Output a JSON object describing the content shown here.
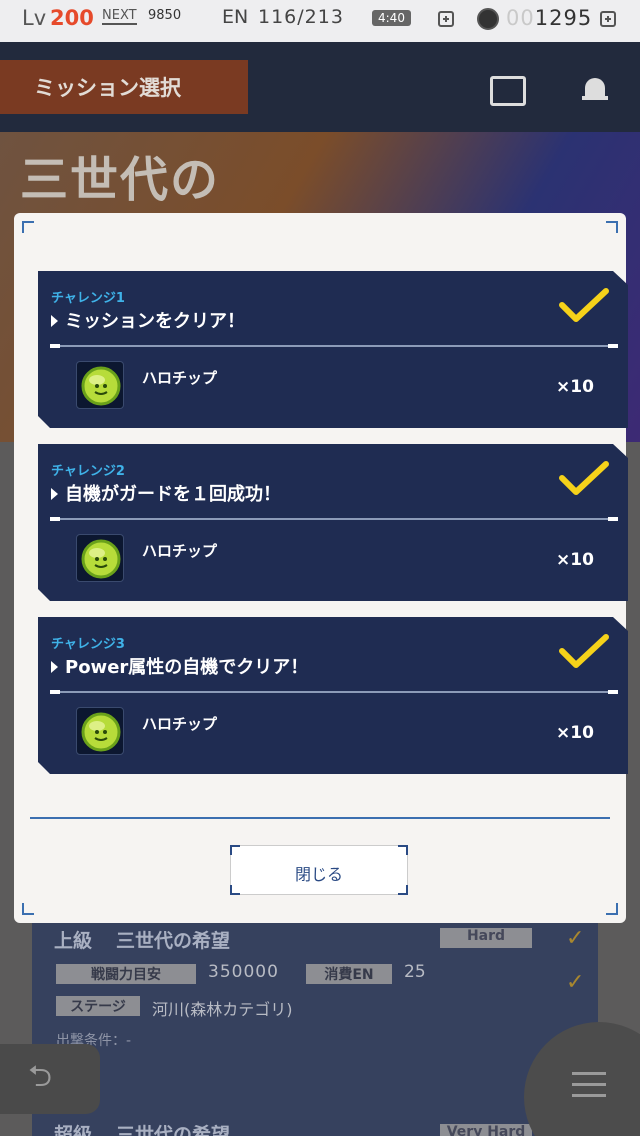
{
  "status_bar": {
    "lv_label": "Lv",
    "lv_value": "200",
    "next_label": "NEXT",
    "next_value": "9850",
    "en_label": "EN",
    "en_value": "116/213",
    "en_timer": "4:40",
    "coins_dim": "00",
    "coins_value": "1295",
    "icons": [
      "plus-icon",
      "coin-icon",
      "plus-icon"
    ]
  },
  "header": {
    "title": "ミッション選択",
    "icons": [
      "shop-icon",
      "bell-icon"
    ]
  },
  "banner": {
    "text": "三世代の"
  },
  "modal": {
    "challenges": [
      {
        "label": "チャレンジ1",
        "text": "ミッションをクリア！",
        "completed": true,
        "reward_name": "ハロチップ",
        "reward_qty": "×10",
        "reward_icon": "haro-chip-icon"
      },
      {
        "label": "チャレンジ2",
        "text": "自機がガードを１回成功！",
        "completed": true,
        "reward_name": "ハロチップ",
        "reward_qty": "×10",
        "reward_icon": "haro-chip-icon"
      },
      {
        "label": "チャレンジ3",
        "text": "Power属性の自機でクリア！",
        "completed": true,
        "reward_name": "ハロチップ",
        "reward_qty": "×10",
        "reward_icon": "haro-chip-icon"
      }
    ],
    "close_label": "閉じる",
    "accent_color": "#f5d21a",
    "card_color": "#1f2c52"
  },
  "mission_detail": {
    "rank": "上級",
    "name": "三世代の希望",
    "difficulty": "Hard",
    "power_label": "戦闘力目安",
    "power_value": "350000",
    "en_label": "消費EN",
    "en_value": "25",
    "stage_label": "ステージ",
    "stage_value": "河川(森林カテゴリ)",
    "condition": "出撃条件：-",
    "next_rank": "超級",
    "next_name": "三世代の希望",
    "next_difficulty": "Very Hard"
  },
  "nav": {
    "back_icon": "back-arrow-icon",
    "menu_icon": "hamburger-menu-icon"
  }
}
